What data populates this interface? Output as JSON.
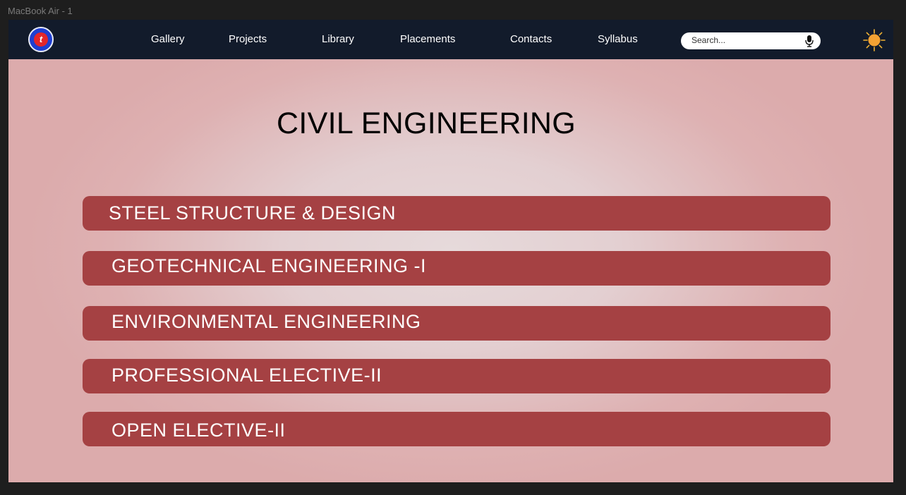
{
  "window": {
    "frame_label": "MacBook Air - 1"
  },
  "navbar": {
    "logo_icon": "college-logo-icon",
    "items": [
      {
        "label": "Gallery"
      },
      {
        "label": "Projects"
      },
      {
        "label": "Library"
      },
      {
        "label": "Placements"
      },
      {
        "label": "Contacts"
      },
      {
        "label": "Syllabus"
      }
    ],
    "search": {
      "placeholder": "Search...",
      "value": "",
      "icon": "microphone-icon"
    },
    "theme_toggle_icon": "sun-icon",
    "background_color": "#121b2b"
  },
  "main": {
    "title": "CIVIL ENGINEERING",
    "subjects": [
      {
        "label": "STEEL  STRUCTURE & DESIGN"
      },
      {
        "label": "GEOTECHNICAL  ENGINEERING -I"
      },
      {
        "label": "ENVIRONMENTAL  ENGINEERING"
      },
      {
        "label": "PROFESSIONAL  ELECTIVE-II"
      },
      {
        "label": "OPEN  ELECTIVE-II"
      }
    ],
    "bar_color": "#a54143",
    "background_color": "#e3cfd1"
  }
}
